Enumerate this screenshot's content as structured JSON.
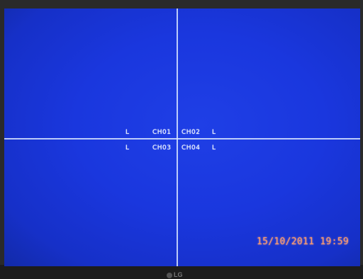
{
  "channels": {
    "ch01": "CH01",
    "ch02": "CH02",
    "ch03": "CH03",
    "ch04": "CH04"
  },
  "status_flags": {
    "ch01": "L",
    "ch02": "L",
    "ch03": "L",
    "ch04": "L"
  },
  "datetime": "15/10/2011  19:59",
  "monitor": {
    "brand": "LG"
  },
  "colors": {
    "screen_blue": "#1a37de",
    "grid_line": "#d9e6ff",
    "datetime": "#ff9a6b"
  }
}
